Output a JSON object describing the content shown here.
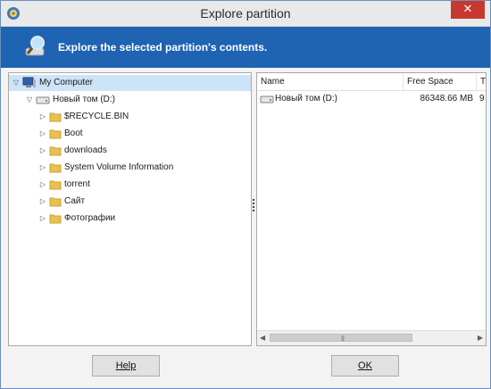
{
  "window": {
    "title": "Explore partition",
    "close_glyph": "✕",
    "icon": "app-disk-icon"
  },
  "banner": {
    "text": "Explore the selected partition's contents.",
    "icon": "magnifier-disk-icon"
  },
  "tree": {
    "root": {
      "label": "My Computer",
      "icon": "computer-icon"
    },
    "drive": {
      "label": "Новый том (D:)",
      "icon": "drive-icon"
    },
    "folders": [
      {
        "label": "$RECYCLE.BIN"
      },
      {
        "label": "Boot"
      },
      {
        "label": "downloads"
      },
      {
        "label": "System Volume Information"
      },
      {
        "label": "torrent"
      },
      {
        "label": "Сайт"
      },
      {
        "label": "Фотографии"
      }
    ]
  },
  "list": {
    "columns": [
      "Name",
      "Free Space",
      "T"
    ],
    "rows": [
      {
        "name": "Новый том (D:)",
        "free_space": "86348.66 MB",
        "type": "9"
      }
    ]
  },
  "buttons": {
    "help": "Help",
    "ok": "OK"
  },
  "colors": {
    "banner": "#1f63b3",
    "close": "#c7392f",
    "selection": "#cde3f7",
    "folder": "#e8c14e"
  }
}
